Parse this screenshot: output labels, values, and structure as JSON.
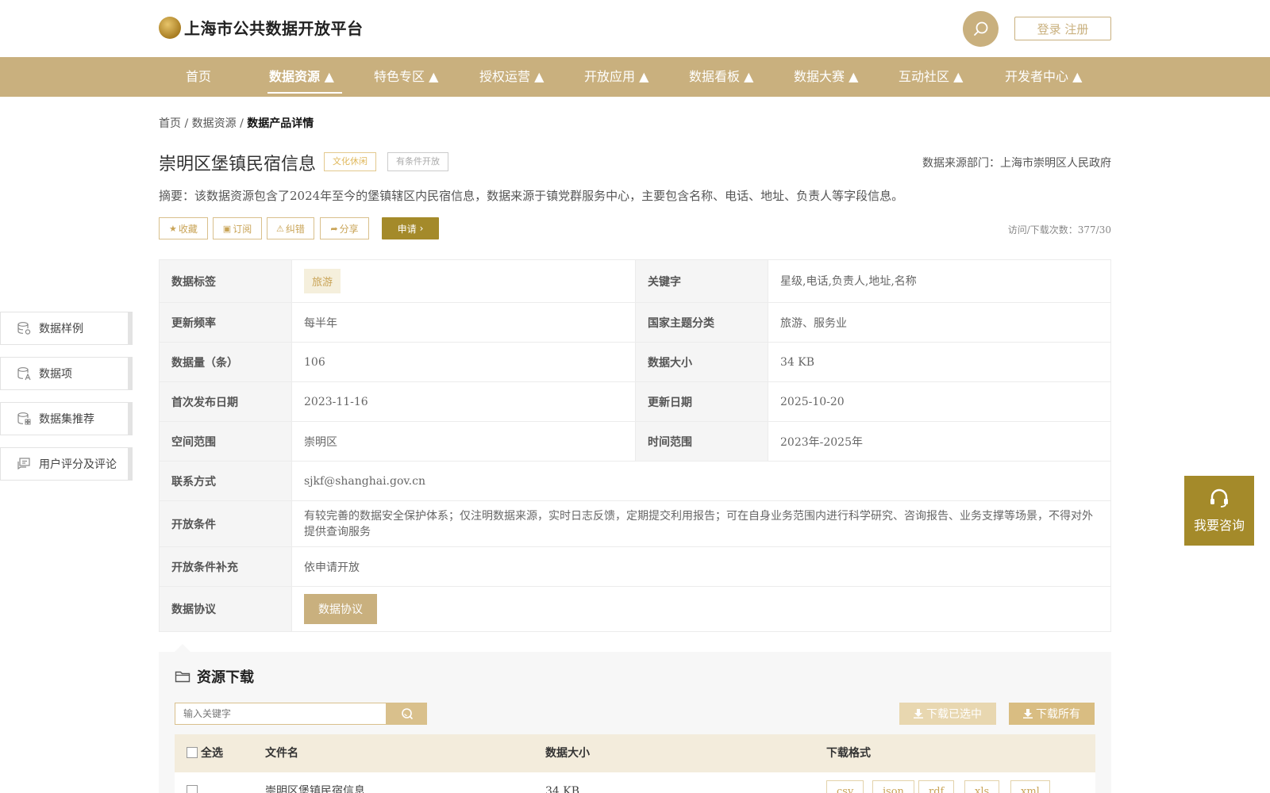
{
  "header": {
    "site_title": "上海市公共数据开放平台",
    "login_label": "登录 注册"
  },
  "nav": {
    "items": [
      {
        "label": "首页"
      },
      {
        "label": "数据资源 ▲"
      },
      {
        "label": "特色专区 ▲"
      },
      {
        "label": "授权运营 ▲"
      },
      {
        "label": "开放应用 ▲"
      },
      {
        "label": "数据看板 ▲"
      },
      {
        "label": "数据大赛 ▲"
      },
      {
        "label": "互动社区 ▲"
      },
      {
        "label": "开发者中心 ▲"
      }
    ],
    "active_index": 1
  },
  "breadcrumb": {
    "home": "首页",
    "sep1": "/",
    "section": "数据资源",
    "sep2": "/",
    "current": "数据产品详情"
  },
  "dataset": {
    "title": "崇明区堡镇民宿信息",
    "tag_category": "文化休闲",
    "tag_open": "有条件开放",
    "source_department": "数据来源部门：上海市崇明区人民政府",
    "summary": "摘要：该数据资源包含了2024年至今的堡镇辖区内民宿信息，数据来源于镇党群服务中心，主要包含名称、电话、地址、负责人等字段信息。",
    "visits_downloads": "访问/下载次数：377/30"
  },
  "actions": {
    "favorite": "收藏",
    "subscribe": "订阅",
    "report": "纠错",
    "share": "分享",
    "apply": "申请"
  },
  "sidebar": {
    "items": [
      {
        "label": "数据样例"
      },
      {
        "label": "数据项"
      },
      {
        "label": "数据集推荐"
      },
      {
        "label": "用户评分及评论"
      }
    ]
  },
  "info": {
    "tags_label": "数据标签",
    "tags_value": "旅游",
    "keywords_label": "关键字",
    "keywords_value": "星级,电话,负责人,地址,名称",
    "update_freq_label": "更新频率",
    "update_freq_value": "每半年",
    "theme_label": "国家主题分类",
    "theme_value": "旅游、服务业",
    "records_label": "数据量（条）",
    "records_value": "106",
    "size_label": "数据大小",
    "size_value": "34 KB",
    "first_pub_label": "首次发布日期",
    "first_pub_value": "2023-11-16",
    "updated_label": "更新日期",
    "updated_value": "2025-10-20",
    "spatial_label": "空间范围",
    "spatial_value": "崇明区",
    "time_label": "时间范围",
    "time_value": "2023年-2025年",
    "contact_label": "联系方式",
    "contact_value": "sjkf@shanghai.gov.cn",
    "condition_label": "开放条件",
    "condition_value": "有较完善的数据安全保护体系；仅注明数据来源，实时日志反馈，定期提交利用报告；可在自身业务范围内进行科学研究、咨询报告、业务支撑等场景，不得对外提供查询服务",
    "condition_extra_label": "开放条件补充",
    "condition_extra_value": "依申请开放",
    "protocol_label": "数据协议",
    "protocol_button": "数据协议"
  },
  "consult": {
    "label": "我要咨询"
  },
  "resources": {
    "title": "资源下载",
    "search_placeholder": "输入关键字",
    "download_selected": "下载已选中",
    "download_all": "下载所有",
    "columns": {
      "select_all": "全选",
      "filename": "文件名",
      "size": "数据大小",
      "format": "下载格式"
    },
    "rows": [
      {
        "filename": "崇明区堡镇民宿信息",
        "size": "34 KB",
        "formats": [
          "csv",
          "json",
          "rdf",
          "xls",
          "xml"
        ]
      }
    ]
  },
  "colors": {
    "accent": "#c9b07e",
    "accent_dark": "#a48a2a",
    "tag_gold": "#e0b85c"
  }
}
